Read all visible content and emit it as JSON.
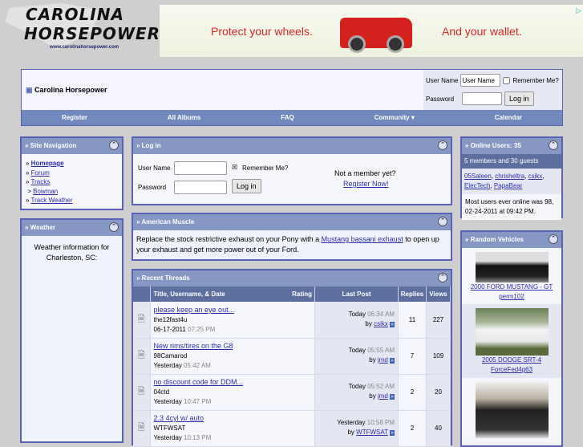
{
  "logo": {
    "line1": "CAROLINA",
    "line2": "HORSEPOWER",
    "url": "www.carolinahorsepower.com"
  },
  "ad": {
    "left": "Protect your wheels.",
    "right": "And your wallet."
  },
  "header": {
    "site_title": "Carolina Horsepower",
    "user_label": "User Name",
    "user_value": "User Name",
    "remember": "Remember Me?",
    "pass_label": "Password",
    "login": "Log in"
  },
  "nav": [
    "Register",
    "All Albums",
    "FAQ",
    "Community ▾",
    "Calendar"
  ],
  "site_nav": {
    "title": "» Site Navigation",
    "items": [
      "Homepage",
      "Forum",
      "Tracks",
      "Bowman",
      "Track Weather"
    ]
  },
  "weather": {
    "title": "» Weather",
    "text": "Weather information for Charleston, SC:"
  },
  "login_box": {
    "title": "» Log in",
    "user_label": "User Name",
    "remember": "Remember Me?",
    "pass_label": "Password",
    "login": "Log in",
    "not_member": "Not a member yet?",
    "register": "Register Now!"
  },
  "muscle": {
    "title": "» American Muscle",
    "pre": "Replace the stock restrictive exhaust on your Pony with a ",
    "link": "Mustang bassani exhaust",
    "post": " to open up your exhaust and get more power out of your Ford."
  },
  "threads": {
    "title": "» Recent Threads",
    "cols": {
      "title": "Title, Username, & Date",
      "rating": "Rating",
      "last": "Last Post",
      "replies": "Replies",
      "views": "Views"
    },
    "rows": [
      {
        "title": "please keep an eye out...",
        "user": "the12fast4u",
        "date": "06-17-2011",
        "time": "07:25 PM",
        "lp_day": "Today",
        "lp_time": "06:34 AM",
        "by": "by",
        "lp_user": "csikx",
        "replies": "11",
        "views": "227"
      },
      {
        "title": "New rims/tires on the G8",
        "user": "98Camarod",
        "date": "Yesterday",
        "time": "05:42 AM",
        "lp_day": "Today",
        "lp_time": "05:55 AM",
        "by": "by",
        "lp_user": "jmd",
        "replies": "7",
        "views": "109"
      },
      {
        "title": "no discount code for DDM...",
        "user": "04ctd",
        "date": "Yesterday",
        "time": "10:47 PM",
        "lp_day": "Today",
        "lp_time": "05:52 AM",
        "by": "by",
        "lp_user": "jmd",
        "replies": "2",
        "views": "20"
      },
      {
        "title": "2.3 4cyl w/ auto",
        "user": "WTFWSAT",
        "date": "Yesterday",
        "time": "10:13 PM",
        "lp_day": "Yesterday",
        "lp_time": "10:58 PM",
        "by": "by",
        "lp_user": "WTFWSAT",
        "replies": "2",
        "views": "40"
      }
    ]
  },
  "online": {
    "title": "» Online Users: 35",
    "summary": "5 members and 30 guests",
    "users": [
      "05Saleen",
      "chrisheltra",
      "csikx",
      "ElecTech",
      "PapaBear"
    ],
    "record": "Most users ever online was 98, 02-24-2011 at 09:42 PM."
  },
  "vehicles": {
    "title": "» Random Vehicles",
    "items": [
      {
        "name": "2000 FORD MUSTANG - GT",
        "owner": "perm102"
      },
      {
        "name": "2005 DODGE SRT-4",
        "owner": "ForceFed4g63"
      }
    ]
  }
}
